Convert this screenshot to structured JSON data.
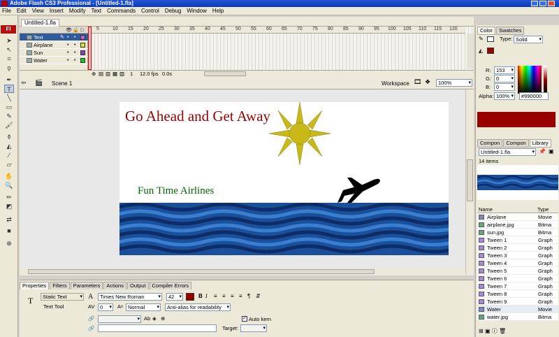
{
  "window": {
    "title": "Adobe Flash CS3 Professional - [Untitled-1.fla]"
  },
  "menu": [
    "File",
    "Edit",
    "View",
    "Insert",
    "Modify",
    "Text",
    "Commands",
    "Control",
    "Debug",
    "Window",
    "Help"
  ],
  "tools": {
    "logo": "Fl"
  },
  "document": {
    "tab": "Untitled-1.fla"
  },
  "timeline": {
    "layers": [
      {
        "name": "Text",
        "color": "#c060c0"
      },
      {
        "name": "Airplane",
        "color": "#e0e020"
      },
      {
        "name": "Sun",
        "color": "#8040c0"
      },
      {
        "name": "Water",
        "color": "#20c020"
      }
    ],
    "ruler": [
      "5",
      "10",
      "15",
      "20",
      "25",
      "30",
      "35",
      "40",
      "45",
      "50",
      "55",
      "60",
      "65",
      "70",
      "75",
      "80",
      "85",
      "90",
      "95",
      "100",
      "105",
      "110",
      "115",
      "120"
    ],
    "frame": "1",
    "fps": "12.0 fps",
    "time": "0.0s"
  },
  "scene": {
    "name": "Scene 1",
    "workspace": "Workspace",
    "zoom": "100%"
  },
  "stage": {
    "headline": "Go Ahead  and Get Away",
    "subline": "Fun Time Airlines",
    "headline_color": "#990000",
    "subline_color": "#006600"
  },
  "properties": {
    "tabs": [
      "Properties",
      "Filters",
      "Parameters",
      "Actions",
      "Output",
      "Compiler Errors"
    ],
    "text_type": "Static Text",
    "tool_label": "Text Tool",
    "font": "Times New Roman",
    "size": "42",
    "letter_spacing": "0",
    "position": "Normal",
    "antialias": "Anti-alias for readability",
    "auto_kern": "Auto kern",
    "target_label": "Target:"
  },
  "color_panel": {
    "tabs": [
      "Color",
      "Swatches"
    ],
    "type_label": "Type:",
    "type": "Solid",
    "r_label": "R:",
    "r": "153",
    "g_label": "G:",
    "g": "0",
    "b_label": "B:",
    "b": "0",
    "alpha_label": "Alpha:",
    "alpha": "100%",
    "hex": "#990000"
  },
  "library": {
    "tabs": [
      "Compon",
      "Compon",
      "Library"
    ],
    "file": "Untitled-1.fla",
    "count": "14 items",
    "col_name": "Name",
    "col_type": "Type",
    "items": [
      {
        "name": "Airplane",
        "type": "Movie"
      },
      {
        "name": "airplane.jpg",
        "type": "Bitma"
      },
      {
        "name": "sun.jpg",
        "type": "Bitma"
      },
      {
        "name": "Tween 1",
        "type": "Graph"
      },
      {
        "name": "Tween 2",
        "type": "Graph"
      },
      {
        "name": "Tween 3",
        "type": "Graph"
      },
      {
        "name": "Tween 4",
        "type": "Graph"
      },
      {
        "name": "Tween 5",
        "type": "Graph"
      },
      {
        "name": "Tween 6",
        "type": "Graph"
      },
      {
        "name": "Tween 7",
        "type": "Graph"
      },
      {
        "name": "Tween 8",
        "type": "Graph"
      },
      {
        "name": "Tween 9",
        "type": "Graph"
      },
      {
        "name": "Water",
        "type": "Movie"
      },
      {
        "name": "water.jpg",
        "type": "Bitma"
      }
    ]
  }
}
